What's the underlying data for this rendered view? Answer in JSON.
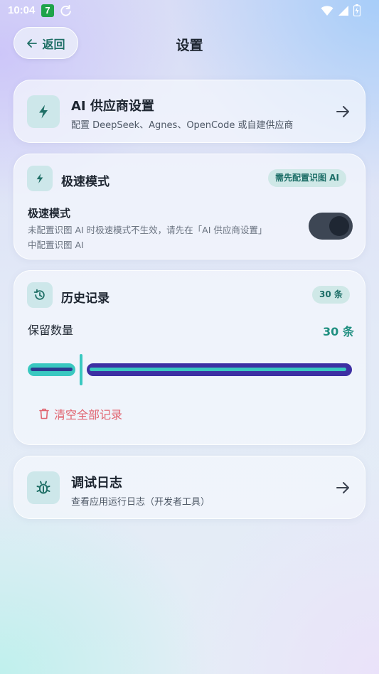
{
  "status_bar": {
    "time": "10:04",
    "app_badge": "7",
    "icons": [
      "sync-icon",
      "wifi-icon",
      "signal-icon",
      "battery-icon"
    ]
  },
  "header": {
    "back_label": "返回",
    "title": "设置"
  },
  "ai_provider": {
    "title": "AI 供应商设置",
    "subtitle": "配置 DeepSeek、Agnes、OpenCode 或自建供应商",
    "icon": "lightning-icon"
  },
  "fast_mode": {
    "title": "极速模式",
    "badge": "需先配置识图 AI",
    "setting_label": "极速模式",
    "setting_desc_line1": "未配置识图 AI 时极速模式不生效，请先在「AI 供应商设置」",
    "setting_desc_line2": "中配置识图 AI",
    "enabled": true,
    "icon": "lightning-icon"
  },
  "history": {
    "title": "历史记录",
    "badge": "30 条",
    "retain_label": "保留数量",
    "retain_value": "30 条",
    "slider_fraction": 0.16,
    "clear_label": "清空全部记录",
    "icon": "history-icon"
  },
  "debug_log": {
    "title": "调试日志",
    "subtitle": "查看应用运行日志（开发者工具）",
    "icon": "bug-icon"
  },
  "colors": {
    "accent": "#1f6f66",
    "slider_active": "#39c8c0",
    "slider_track": "#3d2fa3",
    "danger": "#e06470"
  }
}
